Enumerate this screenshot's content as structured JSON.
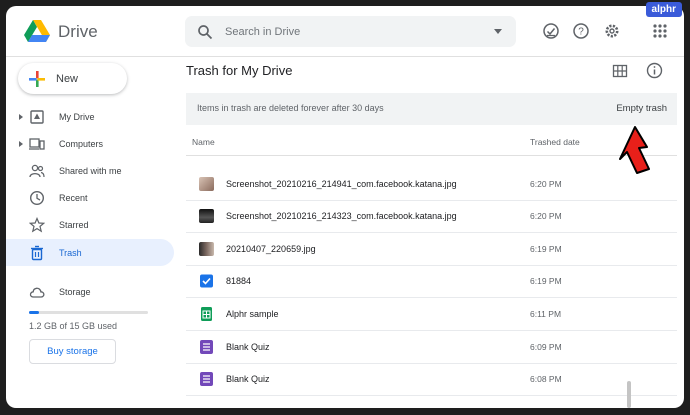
{
  "watermark": "alphr",
  "app": {
    "name": "Drive"
  },
  "search": {
    "placeholder": "Search in Drive"
  },
  "header_icons": [
    "offline-status-icon",
    "help-icon",
    "settings-gear-icon",
    "apps-grid-icon",
    "grid-view-icon",
    "info-icon"
  ],
  "new_button": {
    "label": "New"
  },
  "sidebar": {
    "items": [
      {
        "label": "My Drive",
        "icon": "my-drive-icon",
        "expandable": true
      },
      {
        "label": "Computers",
        "icon": "computers-icon",
        "expandable": true
      },
      {
        "label": "Shared with me",
        "icon": "shared-people-icon",
        "expandable": false
      },
      {
        "label": "Recent",
        "icon": "clock-icon",
        "expandable": false
      },
      {
        "label": "Starred",
        "icon": "star-icon",
        "expandable": false
      },
      {
        "label": "Trash",
        "icon": "trash-icon",
        "expandable": false,
        "active": true
      }
    ],
    "storage": {
      "label": "Storage",
      "used_text": "1.2 GB of 15 GB used",
      "used_fraction": 0.08,
      "buy_label": "Buy storage"
    }
  },
  "main": {
    "title": "Trash for My Drive",
    "banner": {
      "message": "Items in trash are deleted forever after 30 days",
      "action": "Empty trash"
    },
    "columns": {
      "name": "Name",
      "date": "Trashed date"
    },
    "files": [
      {
        "name": "Screenshot_20210216_214941_com.facebook.katana.jpg",
        "date": "6:20 PM",
        "type": "image-light"
      },
      {
        "name": "Screenshot_20210216_214323_com.facebook.katana.jpg",
        "date": "6:20 PM",
        "type": "image-dark"
      },
      {
        "name": "20210407_220659.jpg",
        "date": "6:19 PM",
        "type": "image-photo"
      },
      {
        "name": "81884",
        "date": "6:19 PM",
        "type": "doc-blue"
      },
      {
        "name": "Alphr sample",
        "date": "6:11 PM",
        "type": "sheets"
      },
      {
        "name": "Blank Quiz",
        "date": "6:09 PM",
        "type": "forms"
      },
      {
        "name": "Blank Quiz",
        "date": "6:08 PM",
        "type": "forms"
      }
    ]
  },
  "colors": {
    "accent": "#1a73e8",
    "active_bg": "#e8f0fe",
    "annotation_arrow": "#e8201a"
  }
}
